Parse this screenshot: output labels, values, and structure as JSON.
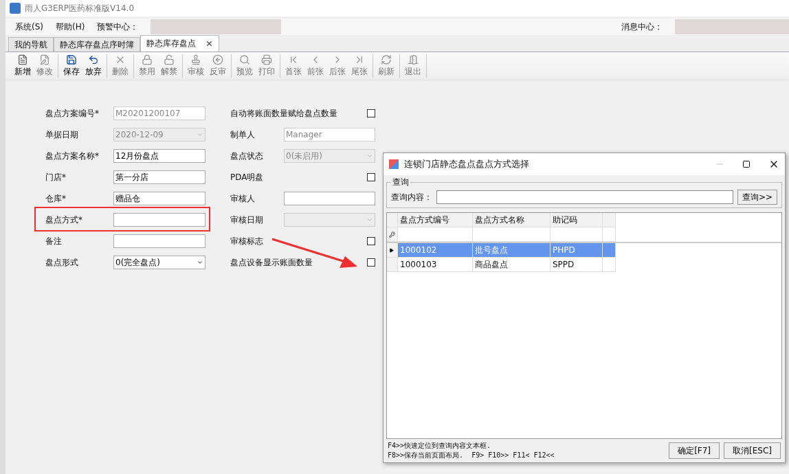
{
  "window": {
    "title": "雨人G3ERP医药标准版V14.0"
  },
  "menu": {
    "items": [
      {
        "label": "系统(S)"
      },
      {
        "label": "帮助(H)"
      }
    ],
    "alert_label": "预警中心：",
    "message_label": "消息中心："
  },
  "tabs": [
    {
      "label": "我的导航",
      "selected": false,
      "closable": false
    },
    {
      "label": "静态库存盘点序时簿",
      "selected": false,
      "closable": false
    },
    {
      "label": "静态库存盘点",
      "selected": true,
      "closable": true
    }
  ],
  "toolbar": [
    [
      {
        "label": "新增",
        "disabled": false
      },
      {
        "label": "修改",
        "disabled": true
      }
    ],
    [
      {
        "label": "保存",
        "disabled": false
      },
      {
        "label": "放弃",
        "disabled": false
      }
    ],
    [
      {
        "label": "删除",
        "disabled": true
      }
    ],
    [
      {
        "label": "禁用",
        "disabled": true
      },
      {
        "label": "解禁",
        "disabled": true
      }
    ],
    [
      {
        "label": "审核",
        "disabled": true
      },
      {
        "label": "反审",
        "disabled": true
      }
    ],
    [
      {
        "label": "预览",
        "disabled": true
      },
      {
        "label": "打印",
        "disabled": true
      }
    ],
    [
      {
        "label": "首张",
        "disabled": true
      },
      {
        "label": "前张",
        "disabled": true
      },
      {
        "label": "后张",
        "disabled": true
      },
      {
        "label": "尾张",
        "disabled": true
      }
    ],
    [
      {
        "label": "刷新",
        "disabled": true
      }
    ],
    [
      {
        "label": "退出",
        "disabled": true
      }
    ]
  ],
  "form_left": [
    {
      "label": "盘点方案编号*",
      "kind": "text",
      "value": "M20201200107",
      "disabled": true
    },
    {
      "label": "单据日期",
      "kind": "combo",
      "value": "2020-12-09",
      "disabled": true
    },
    {
      "label": "盘点方案名称*",
      "kind": "text",
      "value": "12月份盘点",
      "disabled": false
    },
    {
      "label": "门店*",
      "kind": "text",
      "value": "第一分店",
      "disabled": false
    },
    {
      "label": "仓库*",
      "kind": "text",
      "value": "赠品仓",
      "disabled": false
    },
    {
      "label": "盘点方式*",
      "kind": "text",
      "disabled": false,
      "highlighted": true
    },
    {
      "label": "备注",
      "kind": "text",
      "disabled": false
    },
    {
      "label": "盘点形式",
      "kind": "combo",
      "value": "0(完全盘点)",
      "disabled": false
    }
  ],
  "form_right": [
    {
      "label": "自动将账面数量赋给盘点数量",
      "kind": "checkbox",
      "checked": false
    },
    {
      "label": "制单人",
      "kind": "text",
      "value": "Manager",
      "disabled": true
    },
    {
      "label": "盘点状态",
      "kind": "combo",
      "value": "0(未启用)",
      "disabled": true
    },
    {
      "label": "PDA明盘",
      "kind": "checkbox",
      "checked": false
    },
    {
      "label": "审核人",
      "kind": "text",
      "disabled": false
    },
    {
      "label": "审核日期",
      "kind": "combo",
      "disabled": true
    },
    {
      "label": "审核标志",
      "kind": "checkbox",
      "checked": false
    },
    {
      "label": "盘点设备显示账面数量",
      "kind": "checkbox",
      "checked": false
    }
  ],
  "dialog": {
    "title": "连锁门店静态盘点盘点方式选择",
    "query_group": "查询",
    "query_label": "查询内容：",
    "query_button": "查询>>",
    "columns": [
      "盘点方式编号",
      "盘点方式名称",
      "助记码"
    ],
    "rows": [
      {
        "cells": [
          "1000102",
          "批号盘点",
          "PHPD"
        ],
        "selected": true
      },
      {
        "cells": [
          "1000103",
          "商品盘点",
          "SPPD"
        ],
        "selected": false
      }
    ],
    "hints": [
      "F4>>快速定位到查询内容文本框.",
      "F8>>保存当前页面布局.  F9> F10>> F11< F12<<"
    ],
    "buttons": [
      "确定[F7]",
      "取消[ESC]"
    ]
  }
}
